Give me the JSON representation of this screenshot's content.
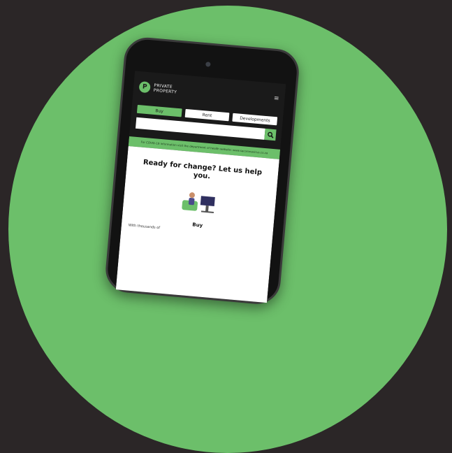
{
  "brand": {
    "line1": "PRIVATE",
    "line2": "PROPERTY",
    "green": "#6cbf6a",
    "dark": "#2b2627"
  },
  "tabs": [
    {
      "label": "Buy",
      "active": true
    },
    {
      "label": "Rent",
      "active": false
    },
    {
      "label": "Developments",
      "active": false
    }
  ],
  "search": {
    "placeholder": "",
    "icon": "search-icon"
  },
  "banner": {
    "text": "For COVID-19 information visit the department of health website: www.sacoronavirus.co.za"
  },
  "hero": {
    "headline": "Ready for change? Let us help you."
  },
  "buy": {
    "title": "Buy",
    "description": "With thousands of"
  }
}
